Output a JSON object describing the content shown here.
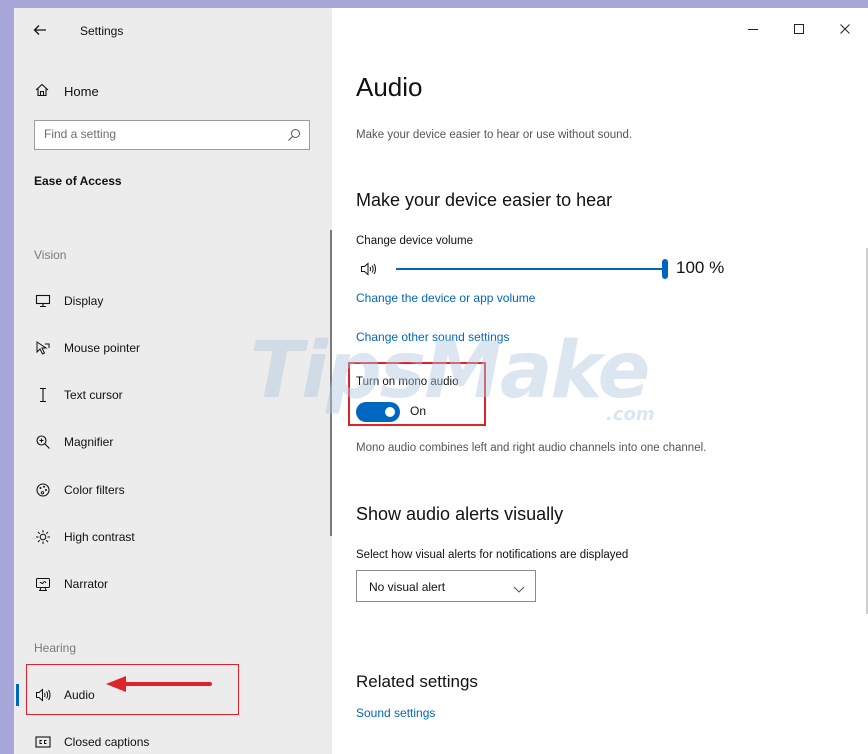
{
  "window": {
    "title": "Settings",
    "controls": [
      "minimize-icon",
      "maximize-icon",
      "close-icon"
    ]
  },
  "sidebar": {
    "home_label": "Home",
    "search_placeholder": "Find a setting",
    "section_title": "Ease of Access",
    "vision_label": "Vision",
    "vision_items": [
      {
        "label": "Display",
        "icon": "display-icon"
      },
      {
        "label": "Mouse pointer",
        "icon": "mouse-pointer-icon"
      },
      {
        "label": "Text cursor",
        "icon": "text-cursor-icon"
      },
      {
        "label": "Magnifier",
        "icon": "magnifier-icon"
      },
      {
        "label": "Color filters",
        "icon": "color-filters-icon"
      },
      {
        "label": "High contrast",
        "icon": "high-contrast-icon"
      },
      {
        "label": "Narrator",
        "icon": "narrator-icon"
      }
    ],
    "hearing_label": "Hearing",
    "hearing_items": [
      {
        "label": "Audio",
        "icon": "audio-icon",
        "selected": true
      },
      {
        "label": "Closed captions",
        "icon": "closed-captions-icon"
      }
    ]
  },
  "main": {
    "title": "Audio",
    "subtitle": "Make your device easier to hear or use without sound.",
    "hear_heading": "Make your device easier to hear",
    "volume_label": "Change device volume",
    "volume_value_text": "100 %",
    "volume_level": 1.0,
    "link_device_app_volume": "Change the device or app volume",
    "link_other_sound": "Change other sound settings",
    "mono_label": "Turn on mono audio",
    "mono_state": "On",
    "mono_on": true,
    "mono_description": "Mono audio combines left and right audio channels into one channel.",
    "alerts_heading": "Show audio alerts visually",
    "alerts_select_label": "Select how visual alerts for notifications are displayed",
    "alerts_select_value": "No visual alert",
    "related_heading": "Related settings",
    "link_sound_settings": "Sound settings"
  },
  "watermark": {
    "text": "TipsMake",
    "suffix": ".com"
  },
  "colors": {
    "accent": "#0067c0",
    "highlight": "#e0222a",
    "background": "#a7a6d8",
    "sidebar": "#ececec"
  }
}
